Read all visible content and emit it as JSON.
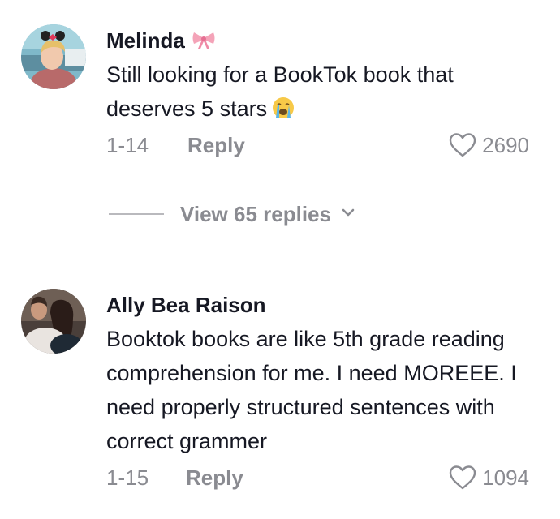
{
  "comments": [
    {
      "username": "Melinda",
      "username_emoji": "ribbon-emoji",
      "text": "Still looking for a BookTok book that deserves 5 stars",
      "text_emoji": "loudly-crying-face-emoji",
      "date": "1-14",
      "reply_label": "Reply",
      "likes": "2690",
      "like_icon": "heart-outline-icon"
    },
    {
      "username": "Ally Bea Raison",
      "text": "Booktok books are like 5th grade reading comprehension for me. I need MOREEE. I need properly structured sentences with correct grammer",
      "date": "1-15",
      "reply_label": "Reply",
      "likes": "1094",
      "like_icon": "heart-outline-icon"
    }
  ],
  "view_replies": {
    "label": "View 65 replies",
    "icon": "chevron-down-icon"
  },
  "colors": {
    "text_primary": "#161823",
    "text_secondary": "#8a8b91",
    "divider": "#b9b9bd"
  }
}
